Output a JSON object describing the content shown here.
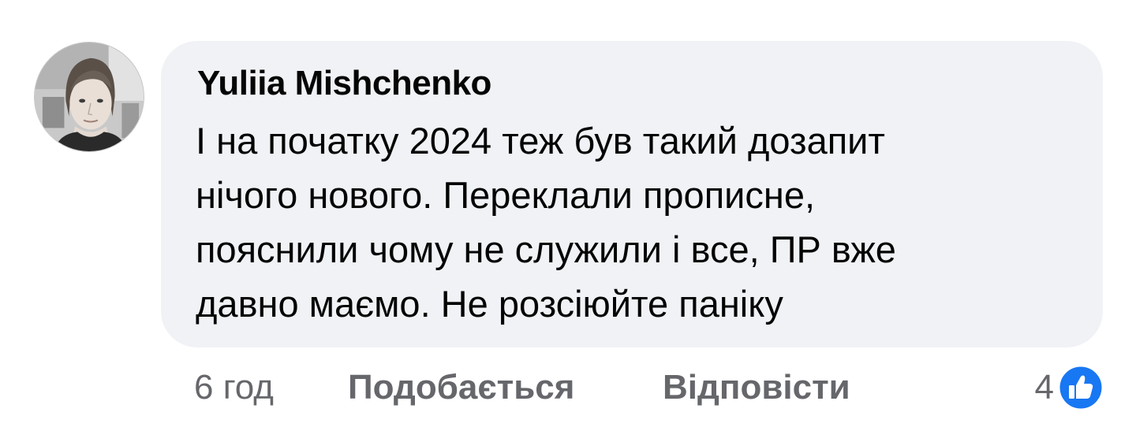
{
  "comment": {
    "author": "Yuliia Mishchenko",
    "lines": [
      "І на початку 2024 теж був такий дозапит",
      "нічого нового. Переклали прописне,",
      "пояснили чому не служили і все, ПР вже",
      "давно маємо. Не розсіюйте паніку"
    ]
  },
  "actions": {
    "time": "6 год",
    "like_label": "Подобається",
    "reply_label": "Відповісти"
  },
  "reactions": {
    "count": "4",
    "icon": "thumbs-up-icon",
    "color": "#1877f2"
  },
  "colors": {
    "bubble_background": "#f0f2f5",
    "text_primary": "#050505",
    "text_secondary": "#65676b"
  }
}
